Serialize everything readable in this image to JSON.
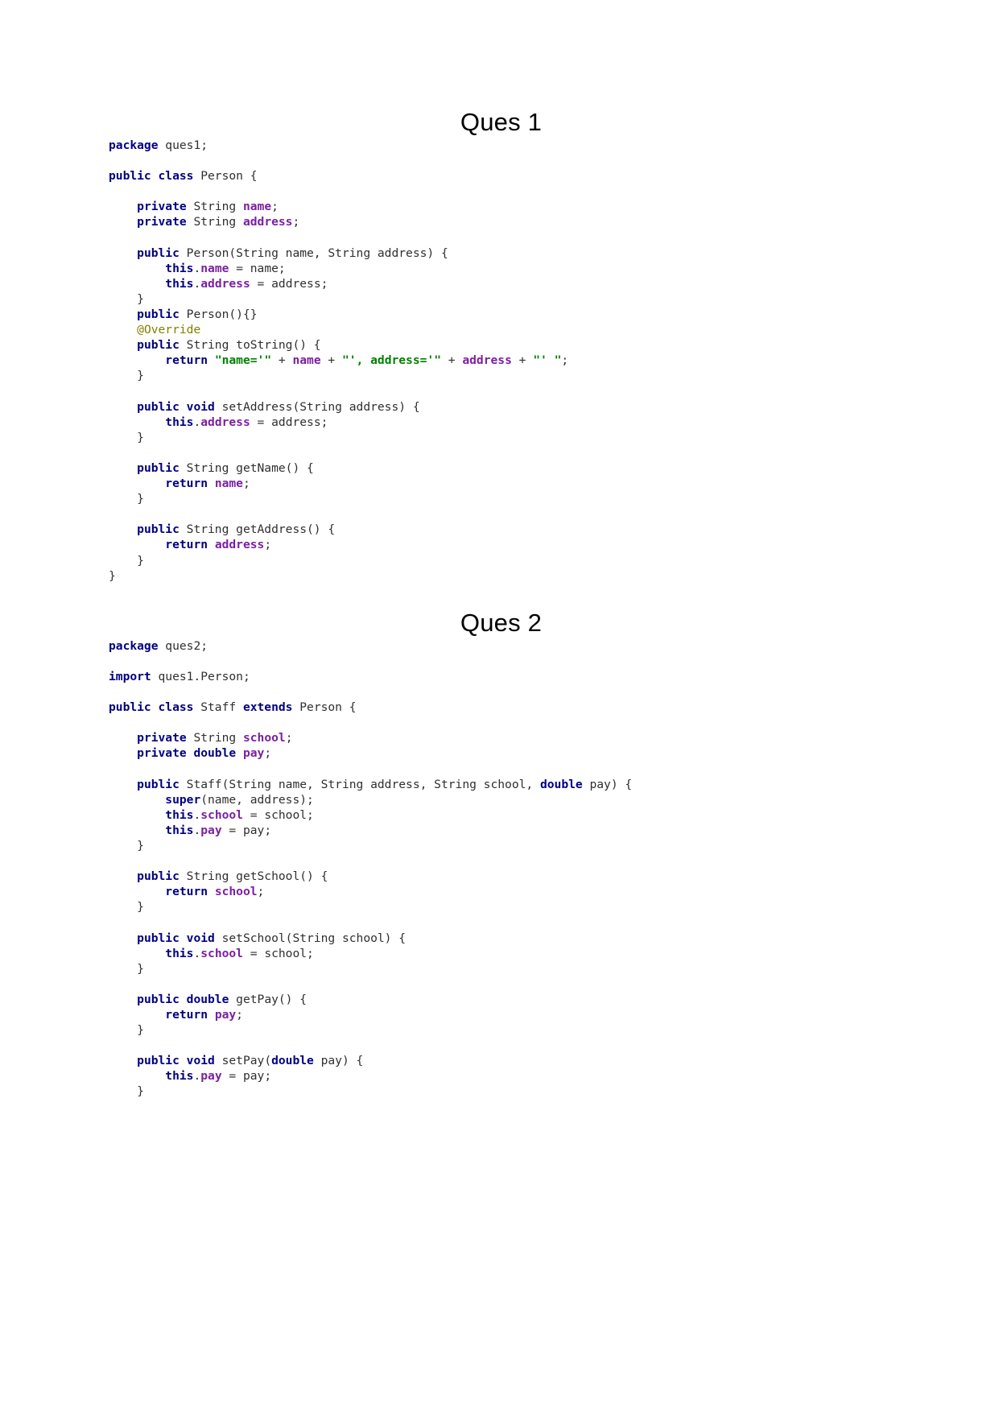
{
  "document": {
    "page_background": "#ffffff",
    "sections": [
      {
        "heading": "Ques 1",
        "code_lines": [
          [
            {
              "t": "package",
              "c": "kw"
            },
            {
              "t": " ques1;",
              "c": "pln"
            }
          ],
          [],
          [
            {
              "t": "public class",
              "c": "kw"
            },
            {
              "t": " Person {",
              "c": "pln"
            }
          ],
          [],
          [
            {
              "t": "    ",
              "c": "pln"
            },
            {
              "t": "private",
              "c": "kw"
            },
            {
              "t": " String ",
              "c": "pln"
            },
            {
              "t": "name",
              "c": "fld"
            },
            {
              "t": ";",
              "c": "pln"
            }
          ],
          [
            {
              "t": "    ",
              "c": "pln"
            },
            {
              "t": "private",
              "c": "kw"
            },
            {
              "t": " String ",
              "c": "pln"
            },
            {
              "t": "address",
              "c": "fld"
            },
            {
              "t": ";",
              "c": "pln"
            }
          ],
          [],
          [
            {
              "t": "    ",
              "c": "pln"
            },
            {
              "t": "public",
              "c": "kw"
            },
            {
              "t": " Person(String name, String address) {",
              "c": "pln"
            }
          ],
          [
            {
              "t": "        ",
              "c": "pln"
            },
            {
              "t": "this",
              "c": "kw"
            },
            {
              "t": ".",
              "c": "pln"
            },
            {
              "t": "name",
              "c": "fld"
            },
            {
              "t": " = name;",
              "c": "pln"
            }
          ],
          [
            {
              "t": "        ",
              "c": "pln"
            },
            {
              "t": "this",
              "c": "kw"
            },
            {
              "t": ".",
              "c": "pln"
            },
            {
              "t": "address",
              "c": "fld"
            },
            {
              "t": " = address;",
              "c": "pln"
            }
          ],
          [
            {
              "t": "    }",
              "c": "pln"
            }
          ],
          [
            {
              "t": "    ",
              "c": "pln"
            },
            {
              "t": "public",
              "c": "kw"
            },
            {
              "t": " Person(){}",
              "c": "pln"
            }
          ],
          [
            {
              "t": "    ",
              "c": "pln"
            },
            {
              "t": "@Override",
              "c": "ann"
            }
          ],
          [
            {
              "t": "    ",
              "c": "pln"
            },
            {
              "t": "public",
              "c": "kw"
            },
            {
              "t": " String toString() {",
              "c": "pln"
            }
          ],
          [
            {
              "t": "        ",
              "c": "pln"
            },
            {
              "t": "return",
              "c": "kw"
            },
            {
              "t": " ",
              "c": "pln"
            },
            {
              "t": "\"name='\"",
              "c": "str"
            },
            {
              "t": " + ",
              "c": "pln"
            },
            {
              "t": "name",
              "c": "fld"
            },
            {
              "t": " + ",
              "c": "pln"
            },
            {
              "t": "\"', address='\"",
              "c": "str"
            },
            {
              "t": " + ",
              "c": "pln"
            },
            {
              "t": "address",
              "c": "fld"
            },
            {
              "t": " + ",
              "c": "pln"
            },
            {
              "t": "\"' \"",
              "c": "str"
            },
            {
              "t": ";",
              "c": "pln"
            }
          ],
          [
            {
              "t": "    }",
              "c": "pln"
            }
          ],
          [],
          [
            {
              "t": "    ",
              "c": "pln"
            },
            {
              "t": "public void",
              "c": "kw"
            },
            {
              "t": " setAddress(String address) {",
              "c": "pln"
            }
          ],
          [
            {
              "t": "        ",
              "c": "pln"
            },
            {
              "t": "this",
              "c": "kw"
            },
            {
              "t": ".",
              "c": "pln"
            },
            {
              "t": "address",
              "c": "fld"
            },
            {
              "t": " = address;",
              "c": "pln"
            }
          ],
          [
            {
              "t": "    }",
              "c": "pln"
            }
          ],
          [],
          [
            {
              "t": "    ",
              "c": "pln"
            },
            {
              "t": "public",
              "c": "kw"
            },
            {
              "t": " String getName() {",
              "c": "pln"
            }
          ],
          [
            {
              "t": "        ",
              "c": "pln"
            },
            {
              "t": "return",
              "c": "kw"
            },
            {
              "t": " ",
              "c": "pln"
            },
            {
              "t": "name",
              "c": "fld"
            },
            {
              "t": ";",
              "c": "pln"
            }
          ],
          [
            {
              "t": "    }",
              "c": "pln"
            }
          ],
          [],
          [
            {
              "t": "    ",
              "c": "pln"
            },
            {
              "t": "public",
              "c": "kw"
            },
            {
              "t": " String getAddress() {",
              "c": "pln"
            }
          ],
          [
            {
              "t": "        ",
              "c": "pln"
            },
            {
              "t": "return",
              "c": "kw"
            },
            {
              "t": " ",
              "c": "pln"
            },
            {
              "t": "address",
              "c": "fld"
            },
            {
              "t": ";",
              "c": "pln"
            }
          ],
          [
            {
              "t": "    }",
              "c": "pln"
            }
          ],
          [
            {
              "t": "}",
              "c": "pln"
            }
          ]
        ]
      },
      {
        "heading": "Ques 2",
        "code_lines": [
          [
            {
              "t": "package",
              "c": "kw"
            },
            {
              "t": " ques2;",
              "c": "pln"
            }
          ],
          [],
          [
            {
              "t": "import",
              "c": "kw"
            },
            {
              "t": " ques1.Person;",
              "c": "pln"
            }
          ],
          [],
          [
            {
              "t": "public class",
              "c": "kw"
            },
            {
              "t": " Staff ",
              "c": "pln"
            },
            {
              "t": "extends",
              "c": "kw"
            },
            {
              "t": " Person {",
              "c": "pln"
            }
          ],
          [],
          [
            {
              "t": "    ",
              "c": "pln"
            },
            {
              "t": "private",
              "c": "kw"
            },
            {
              "t": " String ",
              "c": "pln"
            },
            {
              "t": "school",
              "c": "fld"
            },
            {
              "t": ";",
              "c": "pln"
            }
          ],
          [
            {
              "t": "    ",
              "c": "pln"
            },
            {
              "t": "private double",
              "c": "kw"
            },
            {
              "t": " ",
              "c": "pln"
            },
            {
              "t": "pay",
              "c": "fld"
            },
            {
              "t": ";",
              "c": "pln"
            }
          ],
          [],
          [
            {
              "t": "    ",
              "c": "pln"
            },
            {
              "t": "public",
              "c": "kw"
            },
            {
              "t": " Staff(String name, String address, String school, ",
              "c": "pln"
            },
            {
              "t": "double",
              "c": "kw"
            },
            {
              "t": " pay) {",
              "c": "pln"
            }
          ],
          [
            {
              "t": "        ",
              "c": "pln"
            },
            {
              "t": "super",
              "c": "kw"
            },
            {
              "t": "(name, address);",
              "c": "pln"
            }
          ],
          [
            {
              "t": "        ",
              "c": "pln"
            },
            {
              "t": "this",
              "c": "kw"
            },
            {
              "t": ".",
              "c": "pln"
            },
            {
              "t": "school",
              "c": "fld"
            },
            {
              "t": " = school;",
              "c": "pln"
            }
          ],
          [
            {
              "t": "        ",
              "c": "pln"
            },
            {
              "t": "this",
              "c": "kw"
            },
            {
              "t": ".",
              "c": "pln"
            },
            {
              "t": "pay",
              "c": "fld"
            },
            {
              "t": " = pay;",
              "c": "pln"
            }
          ],
          [
            {
              "t": "    }",
              "c": "pln"
            }
          ],
          [],
          [
            {
              "t": "    ",
              "c": "pln"
            },
            {
              "t": "public",
              "c": "kw"
            },
            {
              "t": " String getSchool() {",
              "c": "pln"
            }
          ],
          [
            {
              "t": "        ",
              "c": "pln"
            },
            {
              "t": "return",
              "c": "kw"
            },
            {
              "t": " ",
              "c": "pln"
            },
            {
              "t": "school",
              "c": "fld"
            },
            {
              "t": ";",
              "c": "pln"
            }
          ],
          [
            {
              "t": "    }",
              "c": "pln"
            }
          ],
          [],
          [
            {
              "t": "    ",
              "c": "pln"
            },
            {
              "t": "public void",
              "c": "kw"
            },
            {
              "t": " setSchool(String school) {",
              "c": "pln"
            }
          ],
          [
            {
              "t": "        ",
              "c": "pln"
            },
            {
              "t": "this",
              "c": "kw"
            },
            {
              "t": ".",
              "c": "pln"
            },
            {
              "t": "school",
              "c": "fld"
            },
            {
              "t": " = school;",
              "c": "pln"
            }
          ],
          [
            {
              "t": "    }",
              "c": "pln"
            }
          ],
          [],
          [
            {
              "t": "    ",
              "c": "pln"
            },
            {
              "t": "public double",
              "c": "kw"
            },
            {
              "t": " getPay() {",
              "c": "pln"
            }
          ],
          [
            {
              "t": "        ",
              "c": "pln"
            },
            {
              "t": "return",
              "c": "kw"
            },
            {
              "t": " ",
              "c": "pln"
            },
            {
              "t": "pay",
              "c": "fld"
            },
            {
              "t": ";",
              "c": "pln"
            }
          ],
          [
            {
              "t": "    }",
              "c": "pln"
            }
          ],
          [],
          [
            {
              "t": "    ",
              "c": "pln"
            },
            {
              "t": "public void",
              "c": "kw"
            },
            {
              "t": " setPay(",
              "c": "pln"
            },
            {
              "t": "double",
              "c": "kw"
            },
            {
              "t": " pay) {",
              "c": "pln"
            }
          ],
          [
            {
              "t": "        ",
              "c": "pln"
            },
            {
              "t": "this",
              "c": "kw"
            },
            {
              "t": ".",
              "c": "pln"
            },
            {
              "t": "pay",
              "c": "fld"
            },
            {
              "t": " = pay;",
              "c": "pln"
            }
          ],
          [
            {
              "t": "    }",
              "c": "pln"
            }
          ]
        ]
      }
    ],
    "syntax_colors": {
      "keyword": "#000080",
      "field": "#7B1FA2",
      "string": "#008000",
      "annotation": "#808000",
      "plain": "#2f2f2f"
    }
  }
}
